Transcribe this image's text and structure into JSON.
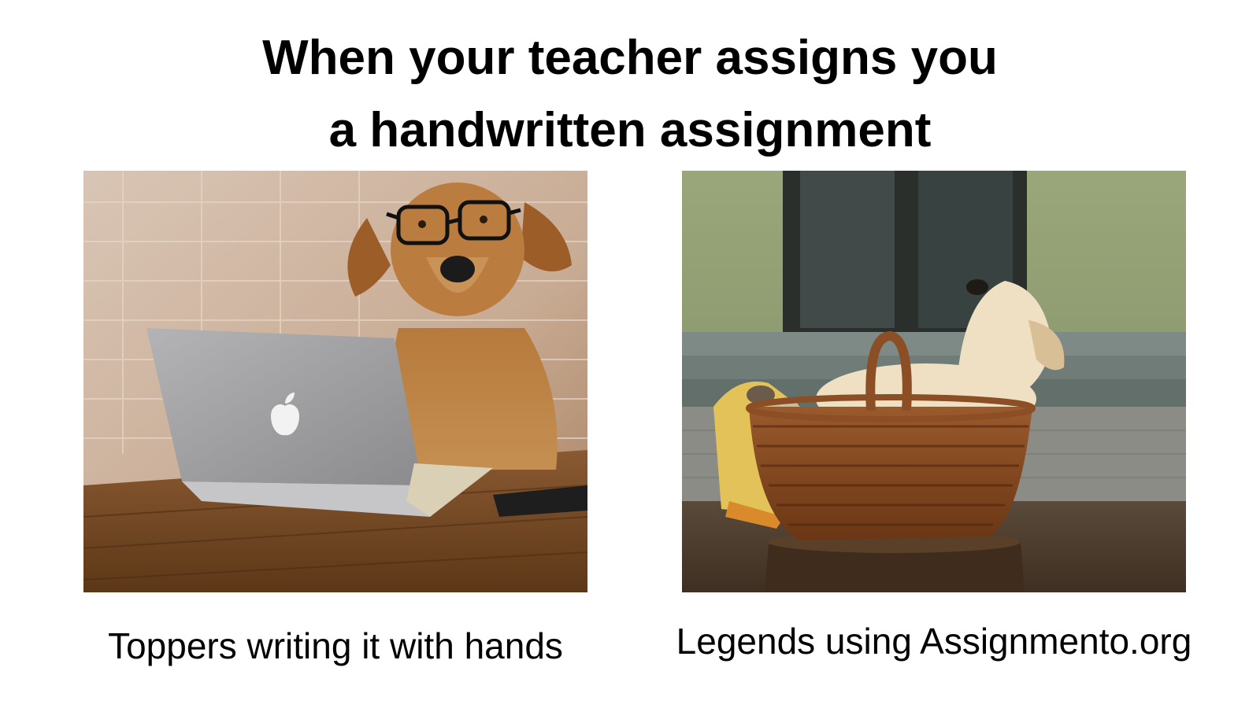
{
  "meme": {
    "title_line1": "When your teacher assigns you",
    "title_line2": "a handwritten assignment",
    "left_caption": "Toppers writing it with hands",
    "right_caption": "Legends using Assignmento.org"
  },
  "colors": {
    "background": "#ffffff",
    "text": "#000000"
  }
}
